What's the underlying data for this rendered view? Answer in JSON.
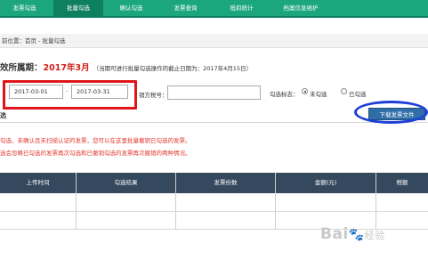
{
  "nav": {
    "tabs": [
      {
        "label": "发票勾选",
        "active": false
      },
      {
        "label": "批量勾选",
        "active": true
      },
      {
        "label": "确认勾选",
        "active": false
      },
      {
        "label": "发票查询",
        "active": false
      },
      {
        "label": "抵扣统计",
        "active": false
      },
      {
        "label": "档案信息维护",
        "active": false
      }
    ]
  },
  "breadcrumb": "前位置：首页 - 批量勾选",
  "period": {
    "label": "效所属期：",
    "value": "2017年3月",
    "note": "（当期可进行批量勾选操作的截止日期为：2017年4月15日）"
  },
  "filters": {
    "start_date": "2017-03-01",
    "separator": "-",
    "end_date": "2017-03-31",
    "sales_tax_label": "销方税号：",
    "sales_tax_value": "",
    "flag_label": "勾选标志：",
    "options": [
      {
        "label": "未勾选",
        "checked": true
      },
      {
        "label": "已勾选",
        "checked": false
      }
    ]
  },
  "section_title": "选",
  "download_button": "下载发票文件",
  "tips": [
    "勾选、未确认且未扫描认证的发票，您可以在这里批量撤销已勾选的发票。",
    "选会忽略已勾选的发票再次勾选和已撤销勾选的发票再次撤销的两种情况。"
  ],
  "table": {
    "headers": [
      "上传时间",
      "勾选结果",
      "发票份数",
      "金额(元)",
      "税额"
    ]
  },
  "watermark": {
    "brand": "Bai",
    "paw": "🐾",
    "suffix": "经验"
  },
  "colors": {
    "nav_green": "#1ca67f",
    "highlight_red": "#e0151b",
    "highlight_blue": "#1d3fd8",
    "table_header": "#34495e",
    "tip_red": "#e23a2e"
  }
}
